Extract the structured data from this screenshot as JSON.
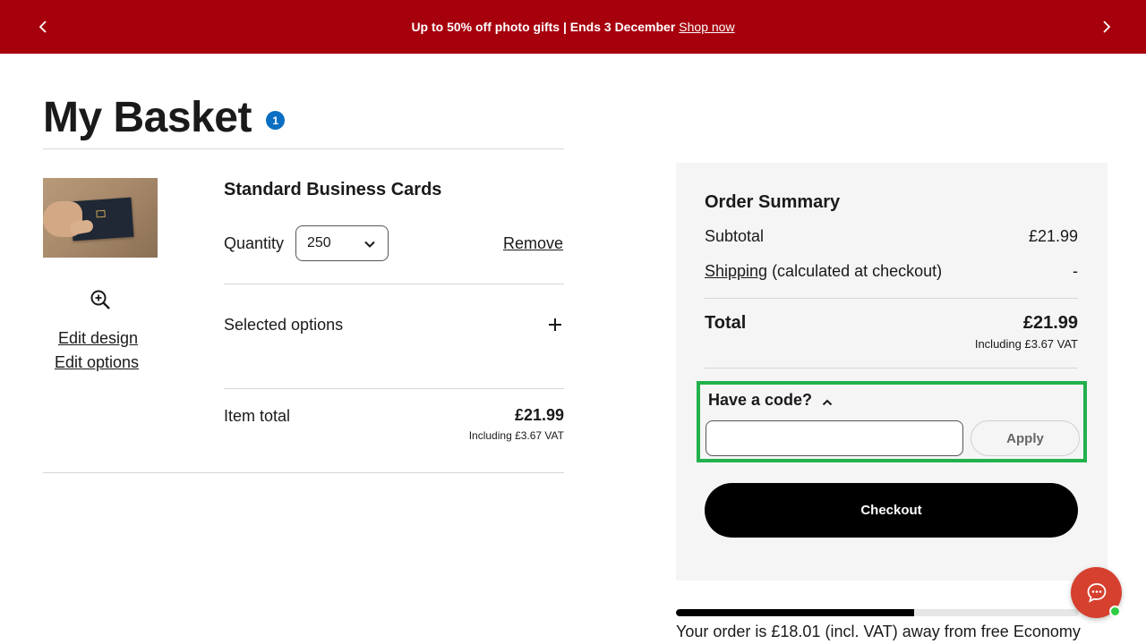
{
  "promo": {
    "text": "Up to 50% off photo gifts | Ends 3 December",
    "link": "Shop now",
    "prev_icon": "chevron-left-icon",
    "next_icon": "chevron-right-icon",
    "background": "#a6000d"
  },
  "basket": {
    "title": "My Basket",
    "count": "1"
  },
  "item": {
    "name": "Standard Business Cards",
    "quantity_label": "Quantity",
    "quantity_value": "250",
    "remove_label": "Remove",
    "edit_design": "Edit design",
    "edit_options": "Edit options",
    "selected_options_label": "Selected options",
    "total_label": "Item total",
    "total_value": "£21.99",
    "total_vat": "Including £3.67 VAT"
  },
  "summary": {
    "title": "Order Summary",
    "subtotal_label": "Subtotal",
    "subtotal_value": "£21.99",
    "shipping_link": "Shipping",
    "shipping_note": " (calculated at checkout)",
    "shipping_value": "-",
    "total_label": "Total",
    "total_value": "£21.99",
    "total_vat": "Including £3.67 VAT",
    "code_toggle": "Have a code?",
    "code_value": "",
    "apply_label": "Apply",
    "checkout_label": "Checkout"
  },
  "free_shipping": {
    "progress_percent": 59,
    "message": "Your order is £18.01 (incl. VAT) away from free Economy"
  },
  "colors": {
    "accent_red": "#a6000d",
    "badge_blue": "#0a6fc2",
    "highlight_green": "#22b14c",
    "chat_red": "#d6402e"
  }
}
